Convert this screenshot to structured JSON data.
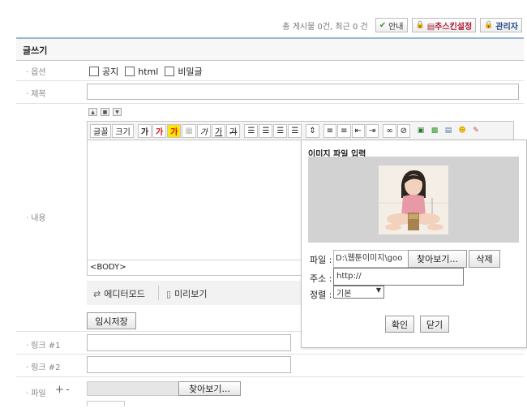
{
  "topbar": {
    "stats": "총 게시물 0건, 최근 0 건",
    "guide_label": "안내",
    "skin_label": "▤추스킨설정",
    "admin_label": "관리자"
  },
  "board": {
    "title": "글쓰기"
  },
  "form": {
    "option_label": "옵션",
    "options": [
      "공지",
      "html",
      "비밀글"
    ],
    "subject_label": "제목",
    "content_label": "내용",
    "link1_label": "링크 #1",
    "link2_label": "링크 #2",
    "file_label": "파일",
    "file_add": "+",
    "file_remove": "-",
    "browse_label": "찾아보기...",
    "temp_save_label": "임시저장"
  },
  "editor": {
    "font_label": "글꼴",
    "size_label": "크기",
    "bold_label": "가",
    "color_label": "가",
    "bg_label": "가",
    "italic_label": "가",
    "underline_label": "가",
    "strike_label": "가",
    "body_tag": "<BODY>",
    "editor_mode_label": "에디터모드",
    "preview_label": "미리보기"
  },
  "image_popup": {
    "title": "이미지 파일 입력",
    "file_label": "파일 :",
    "file_value": "D:\\웹툰이미지\\goo",
    "browse_label": "찾아보기...",
    "delete_label": "삭제",
    "url_label": "주소 :",
    "url_value": "http://",
    "align_label": "정렬 :",
    "align_value": "기본",
    "ok_label": "확인",
    "close_label": "닫기"
  }
}
